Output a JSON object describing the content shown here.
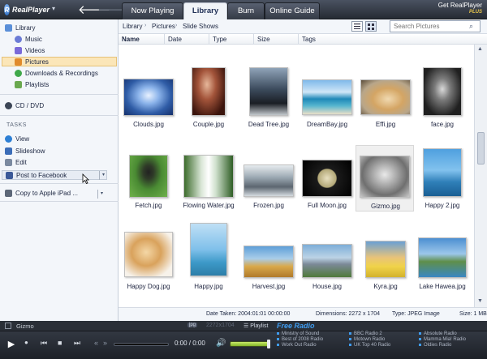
{
  "app": {
    "logo_text": "RealPlayer",
    "get_text": "Get RealPlayer",
    "plus_text": "PLUS"
  },
  "tabs": [
    {
      "label": "Now Playing",
      "active": false
    },
    {
      "label": "Library",
      "active": true
    },
    {
      "label": "Burn",
      "active": false
    },
    {
      "label": "Online Guide",
      "active": false
    }
  ],
  "sidebar": {
    "library": "Library",
    "items": [
      "Music",
      "Videos",
      "Pictures",
      "Downloads & Recordings",
      "Playlists"
    ],
    "selected": "Pictures",
    "cd": "CD / DVD",
    "tasks_header": "TASKS",
    "tasks": [
      "View",
      "Slideshow",
      "Edit",
      "Post to Facebook"
    ],
    "copy": "Copy to Apple iPad ..."
  },
  "breadcrumb": [
    "Library",
    "Pictures",
    "Slide Shows"
  ],
  "search": {
    "placeholder": "Search Pictures"
  },
  "columns": [
    "Name",
    "Date",
    "Type",
    "Size",
    "Tags"
  ],
  "photos": [
    "Clouds.jpg",
    "Couple.jpg",
    "Dead Tree.jpg",
    "DreamBay.jpg",
    "Effi.jpg",
    "face.jpg",
    "Fetch.jpg",
    "Flowing Water.jpg",
    "Frozen.jpg",
    "Full Moon.jpg",
    "Gizmo.jpg",
    "Happy 2.jpg",
    "Happy Dog.jpg",
    "Happy.jpg",
    "Harvest.jpg",
    "House.jpg",
    "Kyra.jpg",
    "Lake Hawea.jpg"
  ],
  "selected_photo": "Gizmo.jpg",
  "info": {
    "date_taken": "Date Taken: 2004:01:01 00:00:00",
    "dimensions": "Dimensions: 2272 x 1704",
    "type": "Type: JPEG Image",
    "size": "Size: 1 MB"
  },
  "player": {
    "now_title": "Gizmo",
    "badge": "jpg",
    "dims": "2272x1704",
    "playlist": "Playlist",
    "free_radio": "Free Radio",
    "time": "0:00 / 0:00",
    "radio_col1": [
      "Ministry of Sound",
      "Best of 2008 Radio",
      "Work Out Radio"
    ],
    "radio_col2": [
      "BBC Radio 2",
      "Motown Radio",
      "UK Top 40 Radio"
    ],
    "radio_col3": [
      "Absolute Radio",
      "Mamma Mia! Radio",
      "Oldies Radio"
    ]
  },
  "colors": {
    "accent": "#3f9cf0",
    "selection": "#fbe6b8"
  }
}
